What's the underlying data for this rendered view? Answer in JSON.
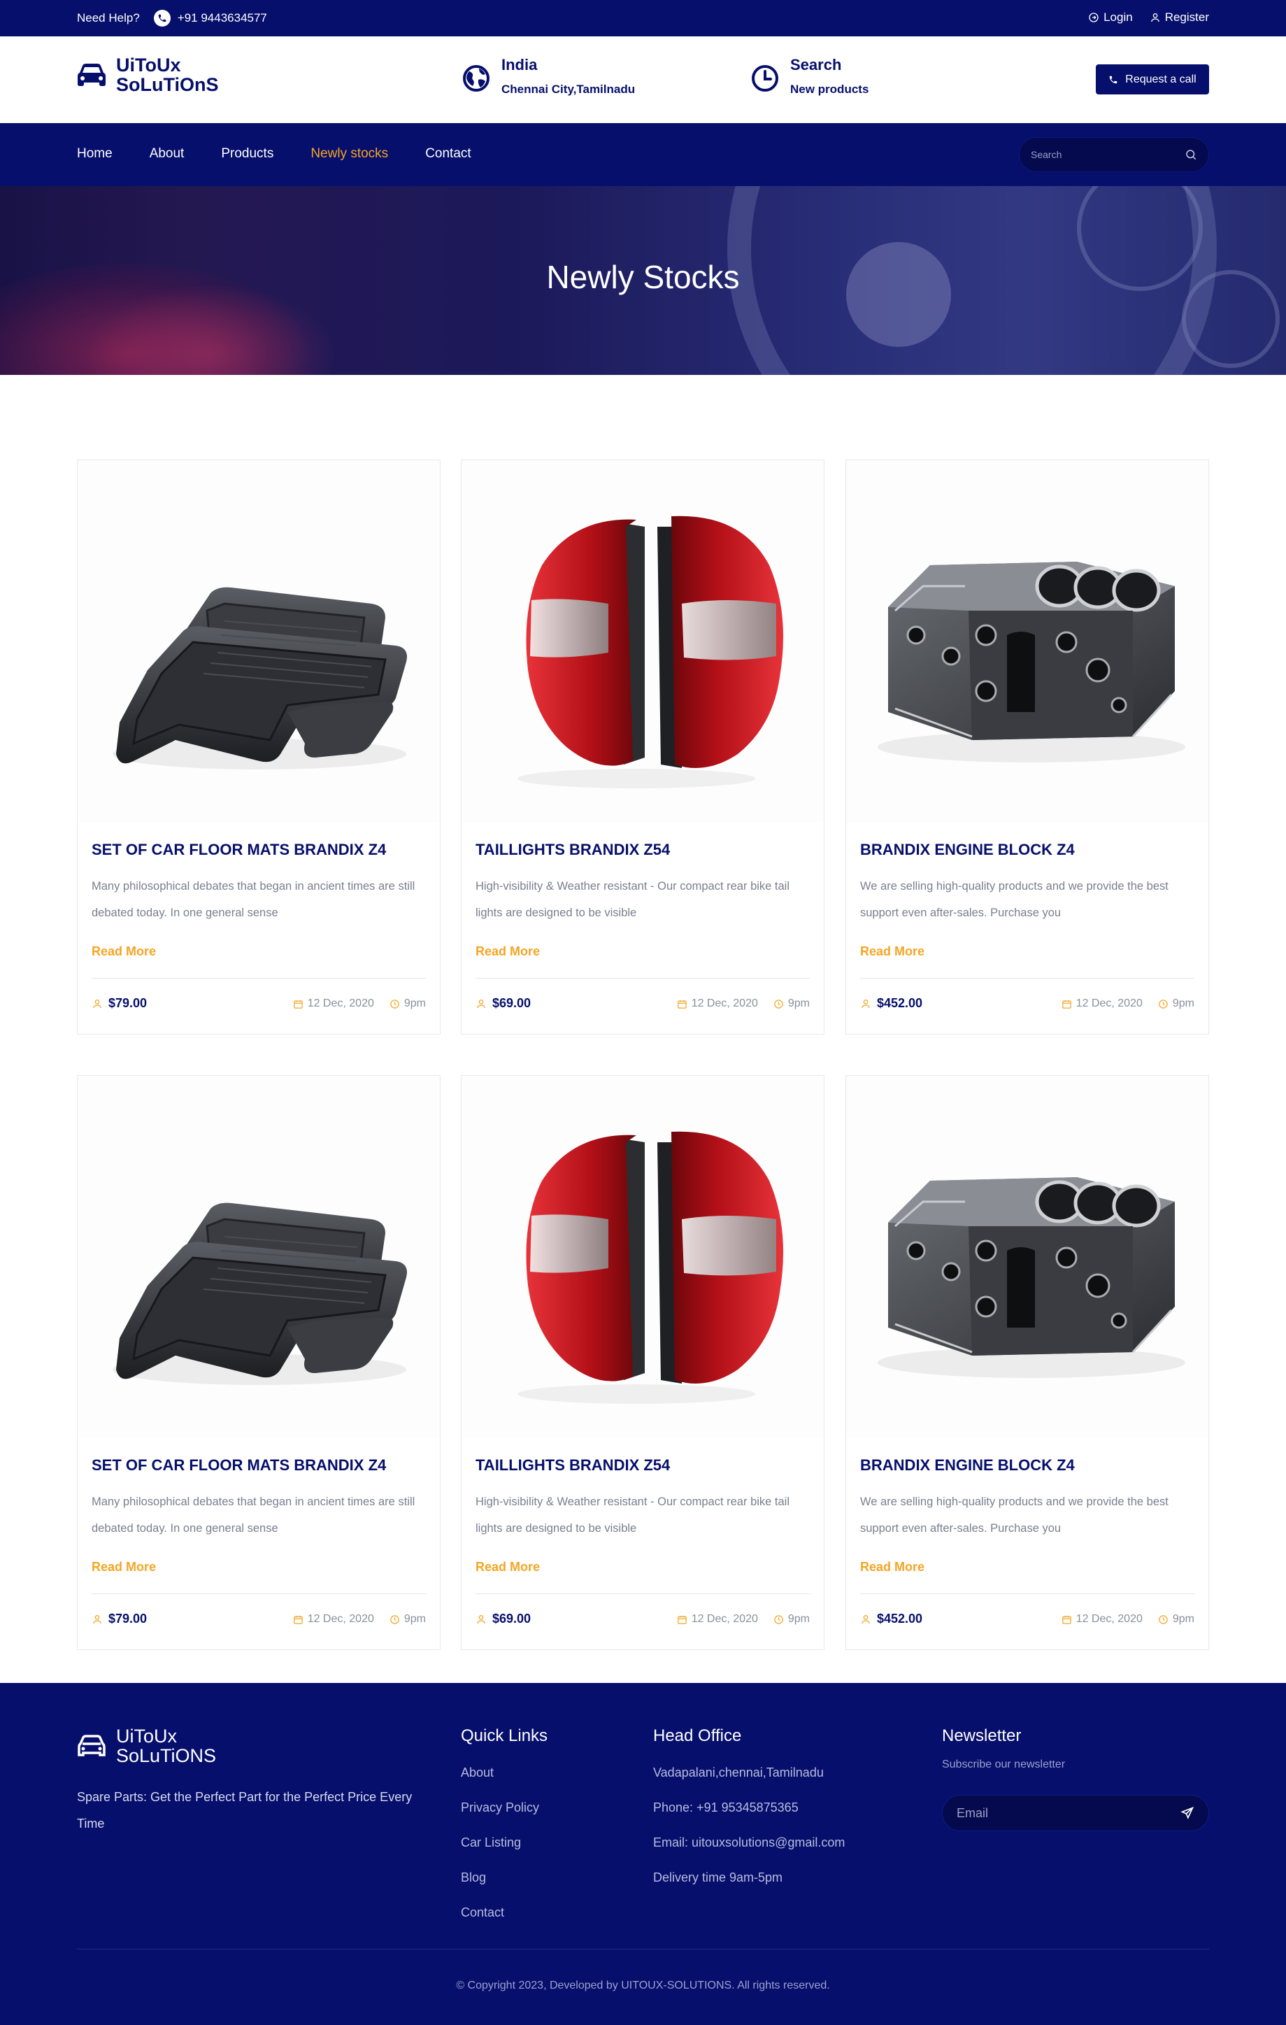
{
  "topbar": {
    "help_label": "Need Help?",
    "phone": "+91 9443634577",
    "login": "Login",
    "register": "Register"
  },
  "header": {
    "brand_line1": "UiToUx",
    "brand_line2": "SoLuTiOnS",
    "location_title": "India",
    "location_sub": "Chennai City,Tamilnadu",
    "search_title": "Search",
    "search_sub": "New products",
    "cta": "Request a call"
  },
  "nav": {
    "items": [
      "Home",
      "About",
      "Products",
      "Newly stocks",
      "Contact"
    ],
    "active": "Newly stocks",
    "search_placeholder": "Search"
  },
  "banner": {
    "title": "Newly Stocks"
  },
  "products": [
    {
      "name": "SET OF CAR FLOOR MATS BRANDIX Z4",
      "desc": "Many philosophical debates that began in ancient times are still debated today. In one general sense",
      "read_more": "Read More",
      "price": "$79.00",
      "date": "12 Dec, 2020",
      "time": "9pm",
      "image": "floor-mats"
    },
    {
      "name": "TAILLIGHTS BRANDIX Z54",
      "desc": "High-visibility & Weather resistant - Our compact rear bike tail lights are designed to be visible",
      "read_more": "Read More",
      "price": "$69.00",
      "date": "12 Dec, 2020",
      "time": "9pm",
      "image": "taillights"
    },
    {
      "name": "BRANDIX ENGINE BLOCK Z4",
      "desc": "We are selling high-quality products and we provide the best support even after-sales. Purchase you",
      "read_more": "Read More",
      "price": "$452.00",
      "date": "12 Dec, 2020",
      "time": "9pm",
      "image": "engine-block"
    },
    {
      "name": "SET OF CAR FLOOR MATS BRANDIX Z4",
      "desc": "Many philosophical debates that began in ancient times are still debated today. In one general sense",
      "read_more": "Read More",
      "price": "$79.00",
      "date": "12 Dec, 2020",
      "time": "9pm",
      "image": "floor-mats"
    },
    {
      "name": "TAILLIGHTS BRANDIX Z54",
      "desc": "High-visibility & Weather resistant - Our compact rear bike tail lights are designed to be visible",
      "read_more": "Read More",
      "price": "$69.00",
      "date": "12 Dec, 2020",
      "time": "9pm",
      "image": "taillights"
    },
    {
      "name": "BRANDIX ENGINE BLOCK Z4",
      "desc": "We are selling high-quality products and we provide the best support even after-sales. Purchase you",
      "read_more": "Read More",
      "price": "$452.00",
      "date": "12 Dec, 2020",
      "time": "9pm",
      "image": "engine-block"
    }
  ],
  "footer": {
    "brand_line1": "UiToUx",
    "brand_line2": "SoLuTiONS",
    "tagline": "Spare Parts: Get the Perfect Part for the Perfect Price Every Time",
    "quick_links_title": "Quick Links",
    "quick_links": [
      "About",
      "Privacy Policy",
      "Car Listing",
      "Blog",
      "Contact"
    ],
    "office_title": "Head Office",
    "office_lines": [
      "Vadapalani,chennai,Tamilnadu",
      "Phone: +91 95345875365",
      "Email: uitouxsolutions@gmail.com",
      "Delivery time 9am-5pm"
    ],
    "newsletter_title": "Newsletter",
    "newsletter_sub": "Subscribe our newsletter",
    "email_placeholder": "Email",
    "copyright": "Copyright 2023, Developed by UITOUX-SOLUTIONS. All rights reserved."
  },
  "colors": {
    "navy": "#060f6b",
    "accent": "#f5a524",
    "muted": "#7a7f8f"
  }
}
